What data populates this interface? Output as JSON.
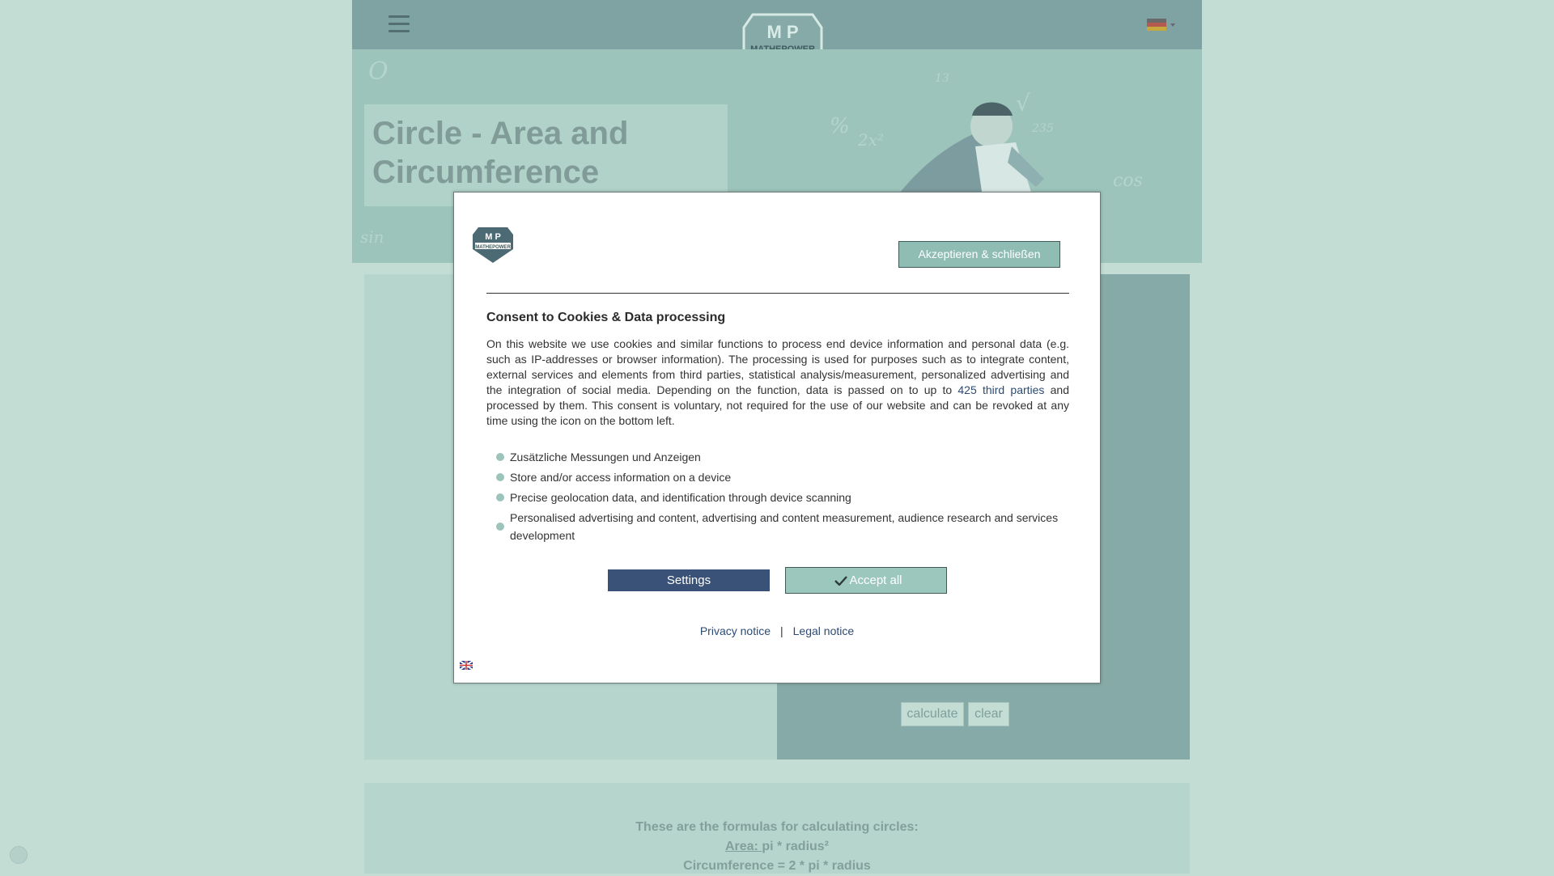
{
  "page": {
    "title": "Circle - Area and Circumference"
  },
  "header": {
    "logo_text": "MATHEPOWER",
    "logo_letters": "M P",
    "language": "de"
  },
  "hero": {
    "chalk": [
      "13",
      "%",
      "2x²",
      "235",
      "√",
      "O",
      "sin",
      "cos"
    ]
  },
  "calculator": {
    "calculate_label": "calculate",
    "clear_label": "clear"
  },
  "formulas": {
    "heading": "These are the formulas for calculating circles:",
    "area_label": "Area: ",
    "area_formula": "pi * radius²",
    "circumference": "Circumference = 2 * pi * radius"
  },
  "cookie_modal": {
    "logo_text": "MATHEPOWER",
    "accept_close_label": "Akzeptieren & schließen",
    "title": "Consent to Cookies & Data processing",
    "text_before_link": "On this website we use cookies and similar functions to process end device information and personal data (e.g. such as IP-addresses or browser information). The processing is used for purposes such as to integrate content, external services and elements from third parties, statistical analysis/measurement, personalized advertising and the integration of social media. Depending on the function, data is passed on to up to ",
    "third_parties_link": "425 third parties",
    "text_after_link": " and processed by them. This consent is voluntary, not required for the use of our website and can be revoked at any time using the icon on the bottom left.",
    "purposes": [
      "Zusätzliche Messungen und Anzeigen",
      "Store and/or access information on a device",
      "Precise geolocation data, and identification through device scanning",
      "Personalised advertising and content, advertising and content measurement, audience research and services development"
    ],
    "settings_label": "Settings",
    "accept_all_label": "Accept all",
    "privacy_notice": "Privacy notice",
    "separator": "|",
    "legal_notice": "Legal notice"
  },
  "colors": {
    "background": "#c3ddd5",
    "topbar": "#7ea3a2",
    "hero": "#9cc4bb",
    "settings_button": "#3a5277",
    "accept_button": "#9cc7bd",
    "link": "#2c4a73"
  }
}
